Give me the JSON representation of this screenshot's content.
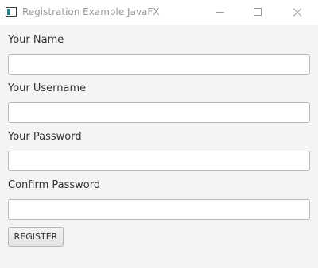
{
  "window": {
    "title": "Registration Example JavaFX",
    "controls": {
      "minimize_icon": "minimize-icon",
      "maximize_icon": "maximize-icon",
      "close_icon": "close-icon"
    }
  },
  "form": {
    "fields": [
      {
        "label": "Your Name",
        "value": "",
        "placeholder": ""
      },
      {
        "label": "Your Username",
        "value": "",
        "placeholder": ""
      },
      {
        "label": "Your Password",
        "value": "",
        "placeholder": ""
      },
      {
        "label": "Confirm Password",
        "value": "",
        "placeholder": ""
      }
    ],
    "submit_label": "REGISTER"
  },
  "colors": {
    "content_background": "#f4f4f4",
    "titlebar_background": "#ffffff",
    "title_text": "#999999",
    "label_text": "#333333",
    "input_border": "#b9b9b9"
  }
}
